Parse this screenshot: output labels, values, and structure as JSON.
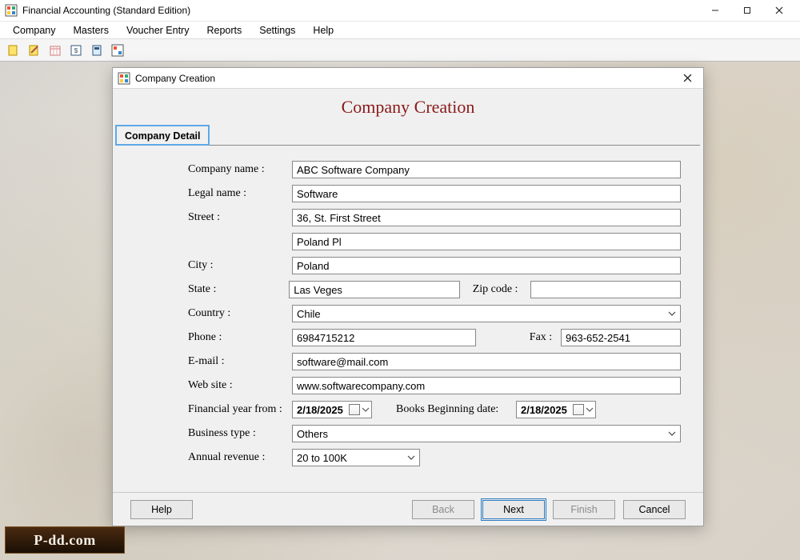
{
  "window": {
    "title": "Financial Accounting (Standard Edition)"
  },
  "menu": {
    "company": "Company",
    "masters": "Masters",
    "voucher": "Voucher Entry",
    "reports": "Reports",
    "settings": "Settings",
    "help": "Help"
  },
  "dialog": {
    "title": "Company Creation",
    "heading": "Company Creation",
    "tab": "Company Detail",
    "labels": {
      "company_name": "Company name :",
      "legal_name": "Legal name :",
      "street": "Street :",
      "city": "City :",
      "state": "State :",
      "zip": "Zip code :",
      "country": "Country :",
      "phone": "Phone :",
      "fax": "Fax :",
      "email": "E-mail :",
      "website": "Web site :",
      "fy_from": "Financial year from :",
      "books_begin": "Books Beginning date:",
      "business_type": "Business type :",
      "annual_revenue": "Annual revenue :"
    },
    "values": {
      "company_name": "ABC Software Company",
      "legal_name": "Software",
      "street1": "36, St. First Street",
      "street2": "Poland Pl",
      "city": "Poland",
      "state": "Las Veges",
      "zip": "",
      "country": "Chile",
      "phone": "6984715212",
      "fax": "963-652-2541",
      "email": "software@mail.com",
      "website": "www.softwarecompany.com",
      "fy_from": "2/18/2025",
      "books_begin": "2/18/2025",
      "business_type": "Others",
      "annual_revenue": "20 to 100K"
    },
    "buttons": {
      "help": "Help",
      "back": "Back",
      "next": "Next",
      "finish": "Finish",
      "cancel": "Cancel"
    }
  },
  "watermark": "P-dd.com"
}
